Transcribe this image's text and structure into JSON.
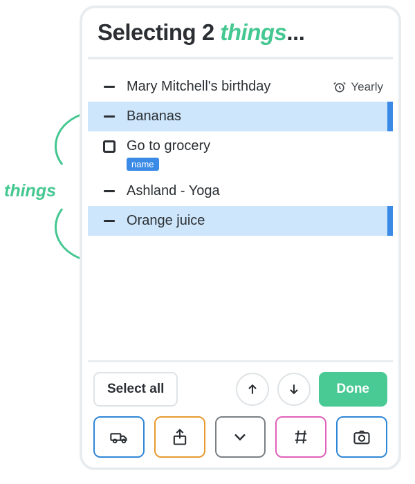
{
  "title": {
    "prefix": "Selecting 2 ",
    "accent": "things",
    "suffix": "..."
  },
  "annotation_label": "things",
  "items": [
    {
      "label": "Mary Mitchell's birthday",
      "recurrence": "Yearly"
    },
    {
      "label": "Bananas"
    },
    {
      "label": "Go to grocery",
      "tag": "name"
    },
    {
      "label": "Ashland - Yoga"
    },
    {
      "label": "Orange juice"
    }
  ],
  "footer": {
    "select_all": "Select all",
    "done": "Done"
  },
  "colors": {
    "accent_green": "#44c790",
    "selection_bg": "#cde6fb",
    "selection_bar": "#3a8ae6"
  }
}
